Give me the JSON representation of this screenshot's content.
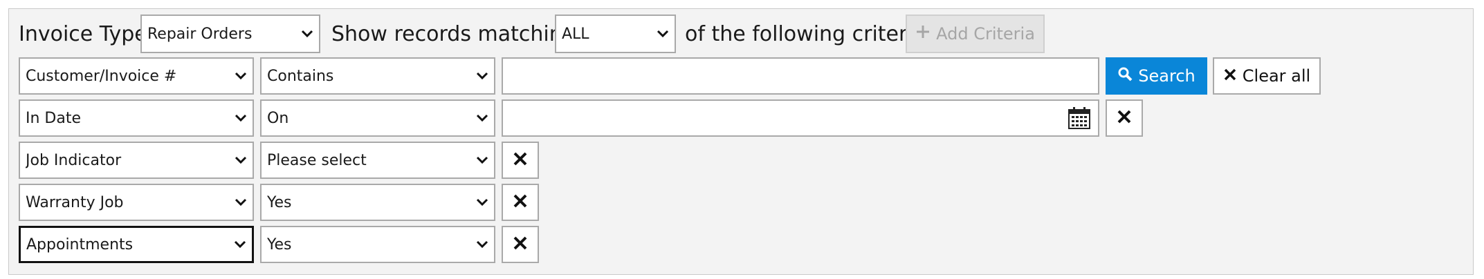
{
  "header": {
    "invoice_type_label": "Invoice Type",
    "invoice_type_value": "Repair Orders",
    "show_records_label": "Show records matching",
    "matching_value": "ALL",
    "following_label": "of the following criteria",
    "add_criteria_label": "Add Criteria"
  },
  "criteria": [
    {
      "field": "Customer/Invoice #",
      "operator": "Contains",
      "value": ""
    },
    {
      "field": "In Date",
      "operator": "On",
      "value": ""
    },
    {
      "field": "Job Indicator",
      "operator": "Please select"
    },
    {
      "field": "Warranty Job",
      "operator": "Yes"
    },
    {
      "field": "Appointments",
      "operator": "Yes"
    }
  ],
  "actions": {
    "search_label": "Search",
    "clear_label": "Clear all"
  },
  "colors": {
    "accent": "#0a86d8",
    "panel_bg": "#f3f3f3",
    "border": "#a9a9a9",
    "disabled_text": "#a6a6a6"
  },
  "icons": [
    "chevron-down-icon",
    "search-icon",
    "close-icon",
    "calendar-icon",
    "plus-icon"
  ]
}
